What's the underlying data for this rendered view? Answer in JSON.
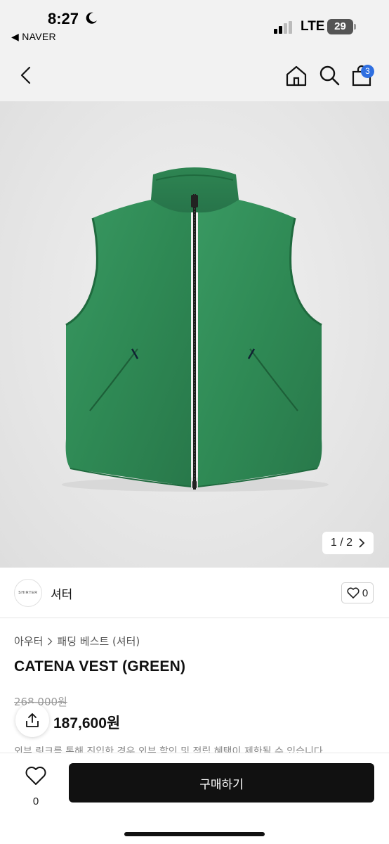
{
  "status_bar": {
    "time": "8:27",
    "back_app": "◀ NAVER",
    "network": "LTE",
    "battery": "29"
  },
  "header": {
    "cart_count": "3"
  },
  "gallery": {
    "counter": "1 / 2",
    "accent_color": "#2f8a55"
  },
  "seller": {
    "logo_text": "SHIRTER",
    "name": "셔터",
    "wish_count": "0"
  },
  "product": {
    "breadcrumb": [
      "아우터",
      "패딩 베스트 (셔터)"
    ],
    "title": "CATENA VEST (GREEN)",
    "original_price": "268,000원",
    "sale_price": "187,600원",
    "notice": "외부 링크를 통해 진입한 경우 외부 할인 및 적립 혜택이 제한될 수 있습니다."
  },
  "bottom_bar": {
    "like_count": "0",
    "buy_label": "구매하기"
  }
}
